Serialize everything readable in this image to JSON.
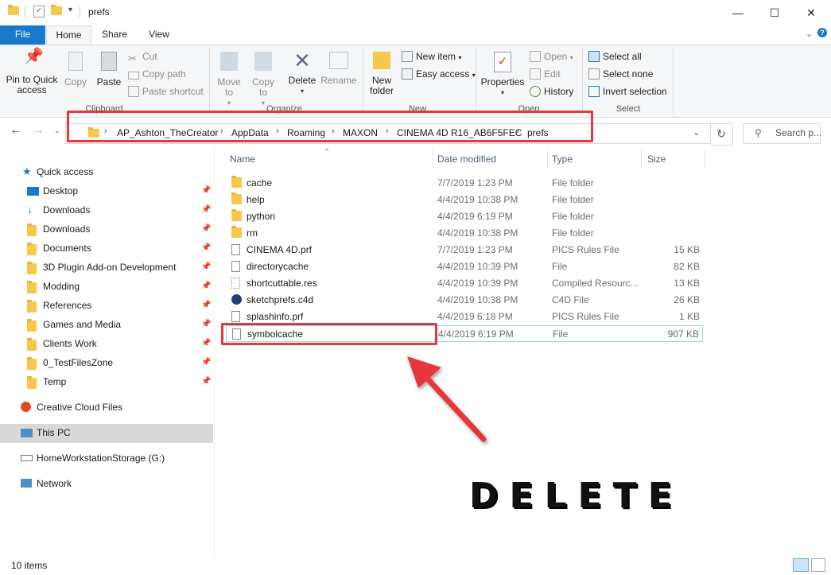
{
  "window": {
    "title": "prefs",
    "controls": {
      "minimize": "—",
      "maximize": "☐",
      "close": "✕"
    }
  },
  "ribbon_tabs": [
    "File",
    "Home",
    "Share",
    "View"
  ],
  "ribbon": {
    "clipboard": {
      "pin_label": "Pin to Quick access",
      "copy_label": "Copy",
      "paste_label": "Paste",
      "cut_label": "Cut",
      "copy_path_label": "Copy path",
      "paste_shortcut_label": "Paste shortcut",
      "group_label": "Clipboard"
    },
    "organize": {
      "move_to_label": "Move to",
      "copy_to_label": "Copy to",
      "delete_label": "Delete",
      "rename_label": "Rename",
      "group_label": "Organize"
    },
    "new": {
      "new_folder_label": "New folder",
      "new_item_label": "New item",
      "easy_access_label": "Easy access",
      "group_label": "New"
    },
    "open": {
      "properties_label": "Properties",
      "open_label": "Open",
      "edit_label": "Edit",
      "history_label": "History",
      "group_label": "Open"
    },
    "select": {
      "select_all_label": "Select all",
      "select_none_label": "Select none",
      "invert_selection_label": "Invert selection",
      "group_label": "Select"
    }
  },
  "address_bar": {
    "breadcrumbs": [
      "AP_Ashton_TheCreator",
      "AppData",
      "Roaming",
      "MAXON",
      "CINEMA 4D R16_AB6F5FEC",
      "prefs"
    ]
  },
  "search": {
    "placeholder": "Search p..."
  },
  "sidebar": {
    "quick_access": "Quick access",
    "pinned": [
      "Desktop",
      "Downloads",
      "Downloads",
      "Documents",
      "3D Plugin Add-on Development",
      "Modding",
      "References",
      "Games and Media",
      "Clients Work",
      "0_TestFilesZone",
      "Temp"
    ],
    "creative_cloud": "Creative Cloud Files",
    "this_pc": "This PC",
    "storage": "HomeWorkstationStorage (G:)",
    "network": "Network"
  },
  "columns": {
    "name": "Name",
    "date": "Date modified",
    "type": "Type",
    "size": "Size"
  },
  "files": [
    {
      "name": "cache",
      "date": "7/7/2019 1:23 PM",
      "type": "File folder",
      "size": ""
    },
    {
      "name": "help",
      "date": "4/4/2019 10:38 PM",
      "type": "File folder",
      "size": ""
    },
    {
      "name": "python",
      "date": "4/4/2019 6:19 PM",
      "type": "File folder",
      "size": ""
    },
    {
      "name": "rm",
      "date": "4/4/2019 10:38 PM",
      "type": "File folder",
      "size": ""
    },
    {
      "name": "CINEMA 4D.prf",
      "date": "7/7/2019 1:23 PM",
      "type": "PICS Rules File",
      "size": "15 KB"
    },
    {
      "name": "directorycache",
      "date": "4/4/2019 10:39 PM",
      "type": "File",
      "size": "82 KB"
    },
    {
      "name": "shortcuttable.res",
      "date": "4/4/2019 10:39 PM",
      "type": "Compiled Resourc...",
      "size": "13 KB"
    },
    {
      "name": "sketchprefs.c4d",
      "date": "4/4/2019 10:38 PM",
      "type": "C4D File",
      "size": "26 KB"
    },
    {
      "name": "splashinfo.prf",
      "date": "4/4/2019 6:18 PM",
      "type": "PICS Rules File",
      "size": "1 KB"
    },
    {
      "name": "symbolcache",
      "date": "4/4/2019 6:19 PM",
      "type": "File",
      "size": "907 KB"
    }
  ],
  "status": {
    "item_count": "10 items"
  },
  "annotation": {
    "text": "DELETE",
    "color": "#e8363a"
  }
}
